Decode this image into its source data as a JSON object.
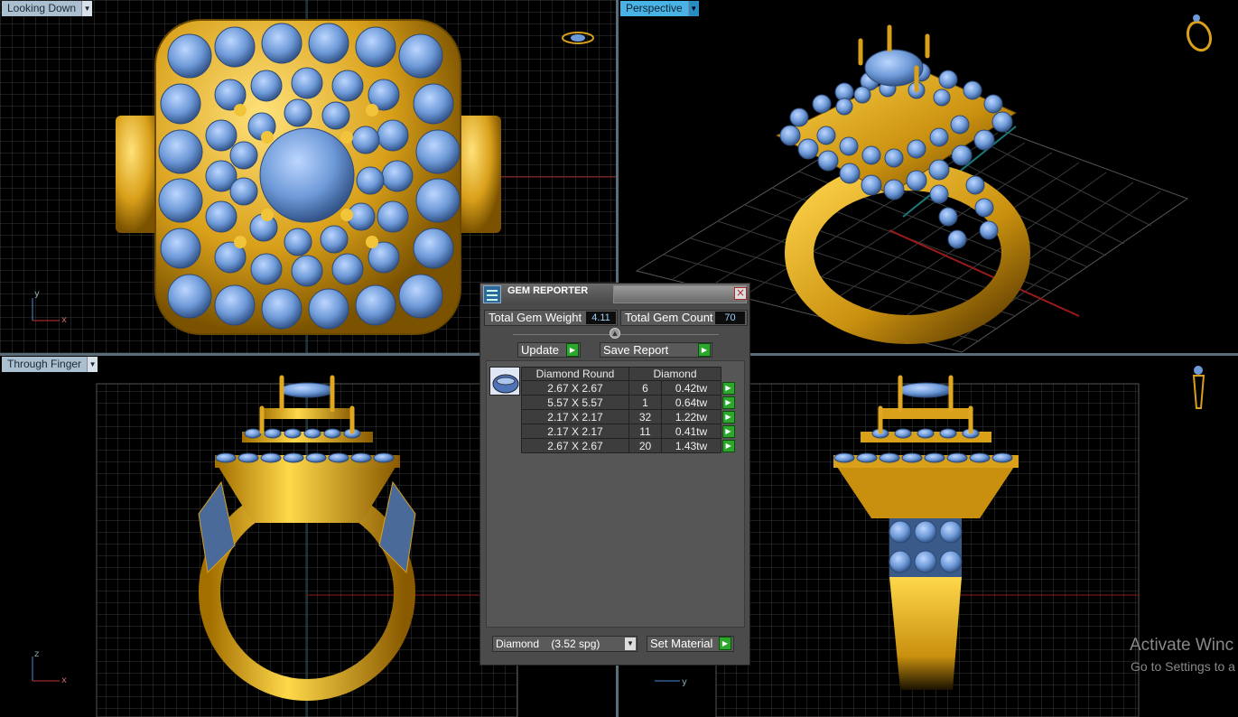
{
  "viewports": {
    "top_left_label": "Looking Down",
    "top_right_label": "Perspective",
    "bottom_left_label": "Through Finger",
    "axes": {
      "top_left": [
        "y",
        "x"
      ],
      "bottom_left": [
        "z",
        "x"
      ],
      "bottom_right": [
        "y"
      ]
    }
  },
  "dialog": {
    "title": "GEM REPORTER",
    "total_weight_label": "Total Gem Weight",
    "total_weight_value": "4.11",
    "total_count_label": "Total Gem Count",
    "total_count_value": "70",
    "update_label": "Update",
    "save_report_label": "Save Report",
    "table_headers": [
      "Diamond Round",
      "Diamond"
    ],
    "rows": [
      {
        "size": "2.67 X 2.67",
        "count": "6",
        "weight": "0.42tw"
      },
      {
        "size": "5.57 X 5.57",
        "count": "1",
        "weight": "0.64tw"
      },
      {
        "size": "2.17 X 2.17",
        "count": "32",
        "weight": "1.22tw"
      },
      {
        "size": "2.17 X 2.17",
        "count": "11",
        "weight": "0.41tw"
      },
      {
        "size": "2.67 X 2.67",
        "count": "20",
        "weight": "1.43tw"
      }
    ],
    "material_value": "Diamond    (3.52 spg)",
    "set_material_label": "Set Material"
  },
  "watermark": {
    "line1": "Activate Winc",
    "line2": "Go to Settings to a"
  },
  "colors": {
    "gold": "#e0a820",
    "gem": "#6e9ad8",
    "grid": "#3e3e3e",
    "active_tab": "#4ab3e6"
  }
}
